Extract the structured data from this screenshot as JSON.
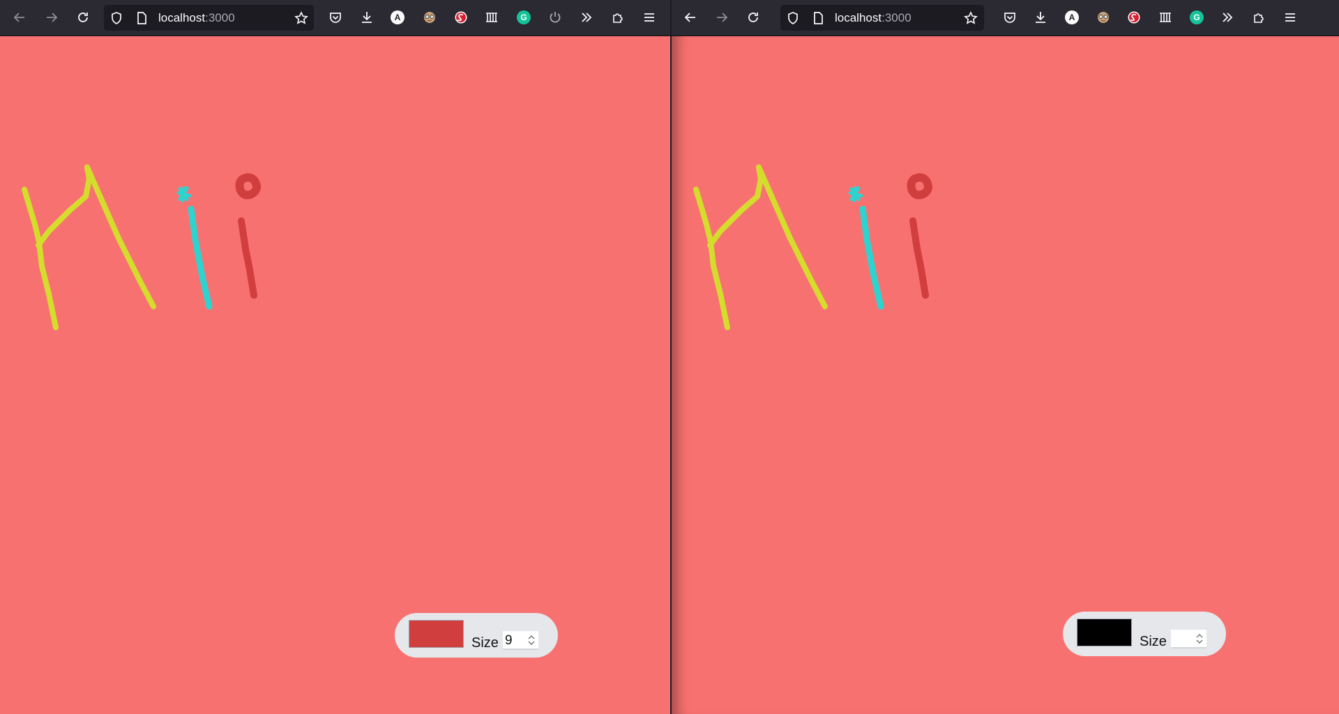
{
  "windows": [
    {
      "id": "left",
      "url": {
        "host": "localhost",
        "port": ":3000"
      },
      "toolbar": {
        "color_picker_value": "#d13e3e",
        "size_label": "Size",
        "size_value": "9"
      }
    },
    {
      "id": "right",
      "url": {
        "host": "localhost",
        "port": ":3000"
      },
      "toolbar": {
        "color_picker_value": "#000000",
        "size_label": "Size",
        "size_value": ""
      }
    }
  ],
  "browser_icons": {
    "nav": [
      "back-icon",
      "forward-icon",
      "reload-icon"
    ],
    "url": [
      "shield-icon",
      "page-icon",
      "star-icon"
    ],
    "extensions": [
      "pocket-icon",
      "download-icon",
      "extension-a-icon",
      "extension-face-icon",
      "extension-s-icon",
      "extension-grid-icon",
      "grammarly-icon",
      "power-icon",
      "overflow-chevron-icon",
      "extensions-puzzle-icon",
      "menu-icon"
    ],
    "ext_letters": {
      "a": "A",
      "g": "G"
    }
  },
  "canvas": {
    "background": "#f87171",
    "drawing_text": "Hii",
    "stroke_colors": {
      "h": "#d4dd2c",
      "first_i": "#2dd4cf",
      "second_i": "#d13e3e"
    }
  }
}
